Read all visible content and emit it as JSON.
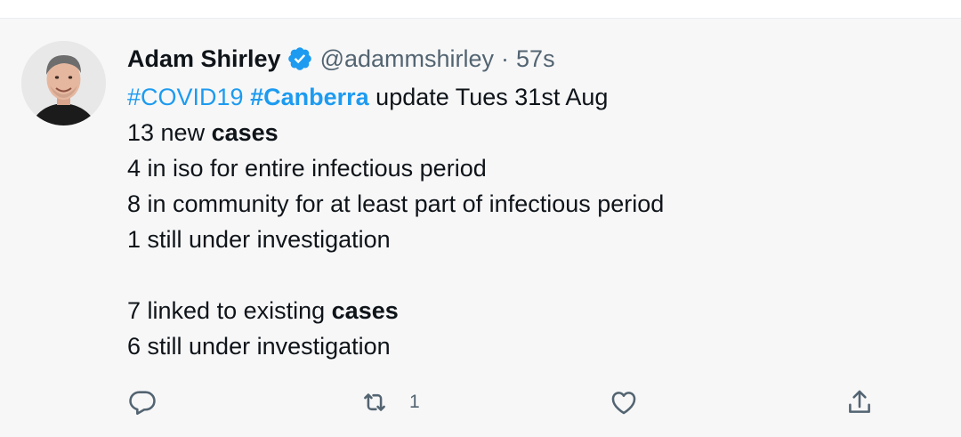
{
  "tweet": {
    "author_name": "Adam Shirley",
    "handle": "@adammshirley",
    "separator": "·",
    "time": "57s",
    "line1": {
      "hashtag1": "#COVID19",
      "hashtag2": "#Canberra",
      "rest": "update Tues 31st Aug"
    },
    "line2": {
      "text": "13 new",
      "bold": "cases"
    },
    "line3": "4 in iso for entire infectious period",
    "line4": "8 in community for at least part of infectious period",
    "line5": "1 still under investigation",
    "line6": {
      "text": "7 linked to existing",
      "bold": "cases"
    },
    "line7": "6 still under investigation"
  },
  "actions": {
    "reply_icon": "reply-icon",
    "retweet_icon": "retweet-icon",
    "retweet_count": "1",
    "like_icon": "heart-icon",
    "share_icon": "share-icon"
  },
  "colors": {
    "link": "#1d9bf0",
    "secondary_text": "#536471",
    "primary_text": "#0f1419",
    "background": "#f7f7f8"
  }
}
